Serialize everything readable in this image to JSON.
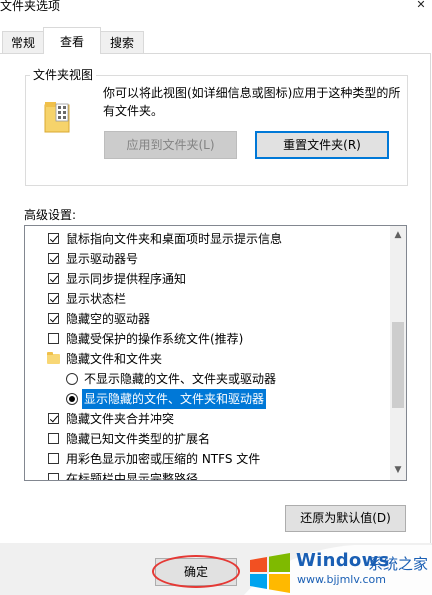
{
  "window": {
    "title": "文件夹选项"
  },
  "tabs": [
    {
      "label": "常规",
      "active": false
    },
    {
      "label": "查看",
      "active": true
    },
    {
      "label": "搜索",
      "active": false
    }
  ],
  "folder_views": {
    "legend": "文件夹视图",
    "description": "你可以将此视图(如详细信息或图标)应用于这种类型的所有文件夹。",
    "apply_button": "应用到文件夹(L)",
    "reset_button": "重置文件夹(R)"
  },
  "advanced": {
    "label": "高级设置:",
    "items": [
      {
        "type": "checkbox",
        "checked": true,
        "indent": 0,
        "label": "鼠标指向文件夹和桌面项时显示提示信息"
      },
      {
        "type": "checkbox",
        "checked": true,
        "indent": 0,
        "label": "显示驱动器号"
      },
      {
        "type": "checkbox",
        "checked": true,
        "indent": 0,
        "label": "显示同步提供程序通知"
      },
      {
        "type": "checkbox",
        "checked": true,
        "indent": 0,
        "label": "显示状态栏"
      },
      {
        "type": "checkbox",
        "checked": true,
        "indent": 0,
        "label": "隐藏空的驱动器"
      },
      {
        "type": "checkbox",
        "checked": false,
        "indent": 0,
        "label": "隐藏受保护的操作系统文件(推荐)"
      },
      {
        "type": "folder",
        "indent": 0,
        "label": "隐藏文件和文件夹"
      },
      {
        "type": "radio",
        "selected": false,
        "indent": 1,
        "label": "不显示隐藏的文件、文件夹或驱动器"
      },
      {
        "type": "radio",
        "selected": true,
        "indent": 1,
        "label": "显示隐藏的文件、文件夹和驱动器",
        "highlighted": true
      },
      {
        "type": "checkbox",
        "checked": true,
        "indent": 0,
        "label": "隐藏文件夹合并冲突"
      },
      {
        "type": "checkbox",
        "checked": false,
        "indent": 0,
        "label": "隐藏已知文件类型的扩展名"
      },
      {
        "type": "checkbox",
        "checked": false,
        "indent": 0,
        "label": "用彩色显示加密或压缩的 NTFS 文件"
      },
      {
        "type": "checkbox",
        "checked": false,
        "indent": 0,
        "label": "在标题栏中显示完整路径"
      }
    ],
    "restore_button": "还原为默认值(D)"
  },
  "footer": {
    "ok_button": "确定"
  },
  "watermark": {
    "brand": "Windows",
    "cn": "系统之家",
    "url": "www.bjjmlv.com"
  },
  "colors": {
    "accent": "#0078d7",
    "annotation": "#e53935"
  }
}
